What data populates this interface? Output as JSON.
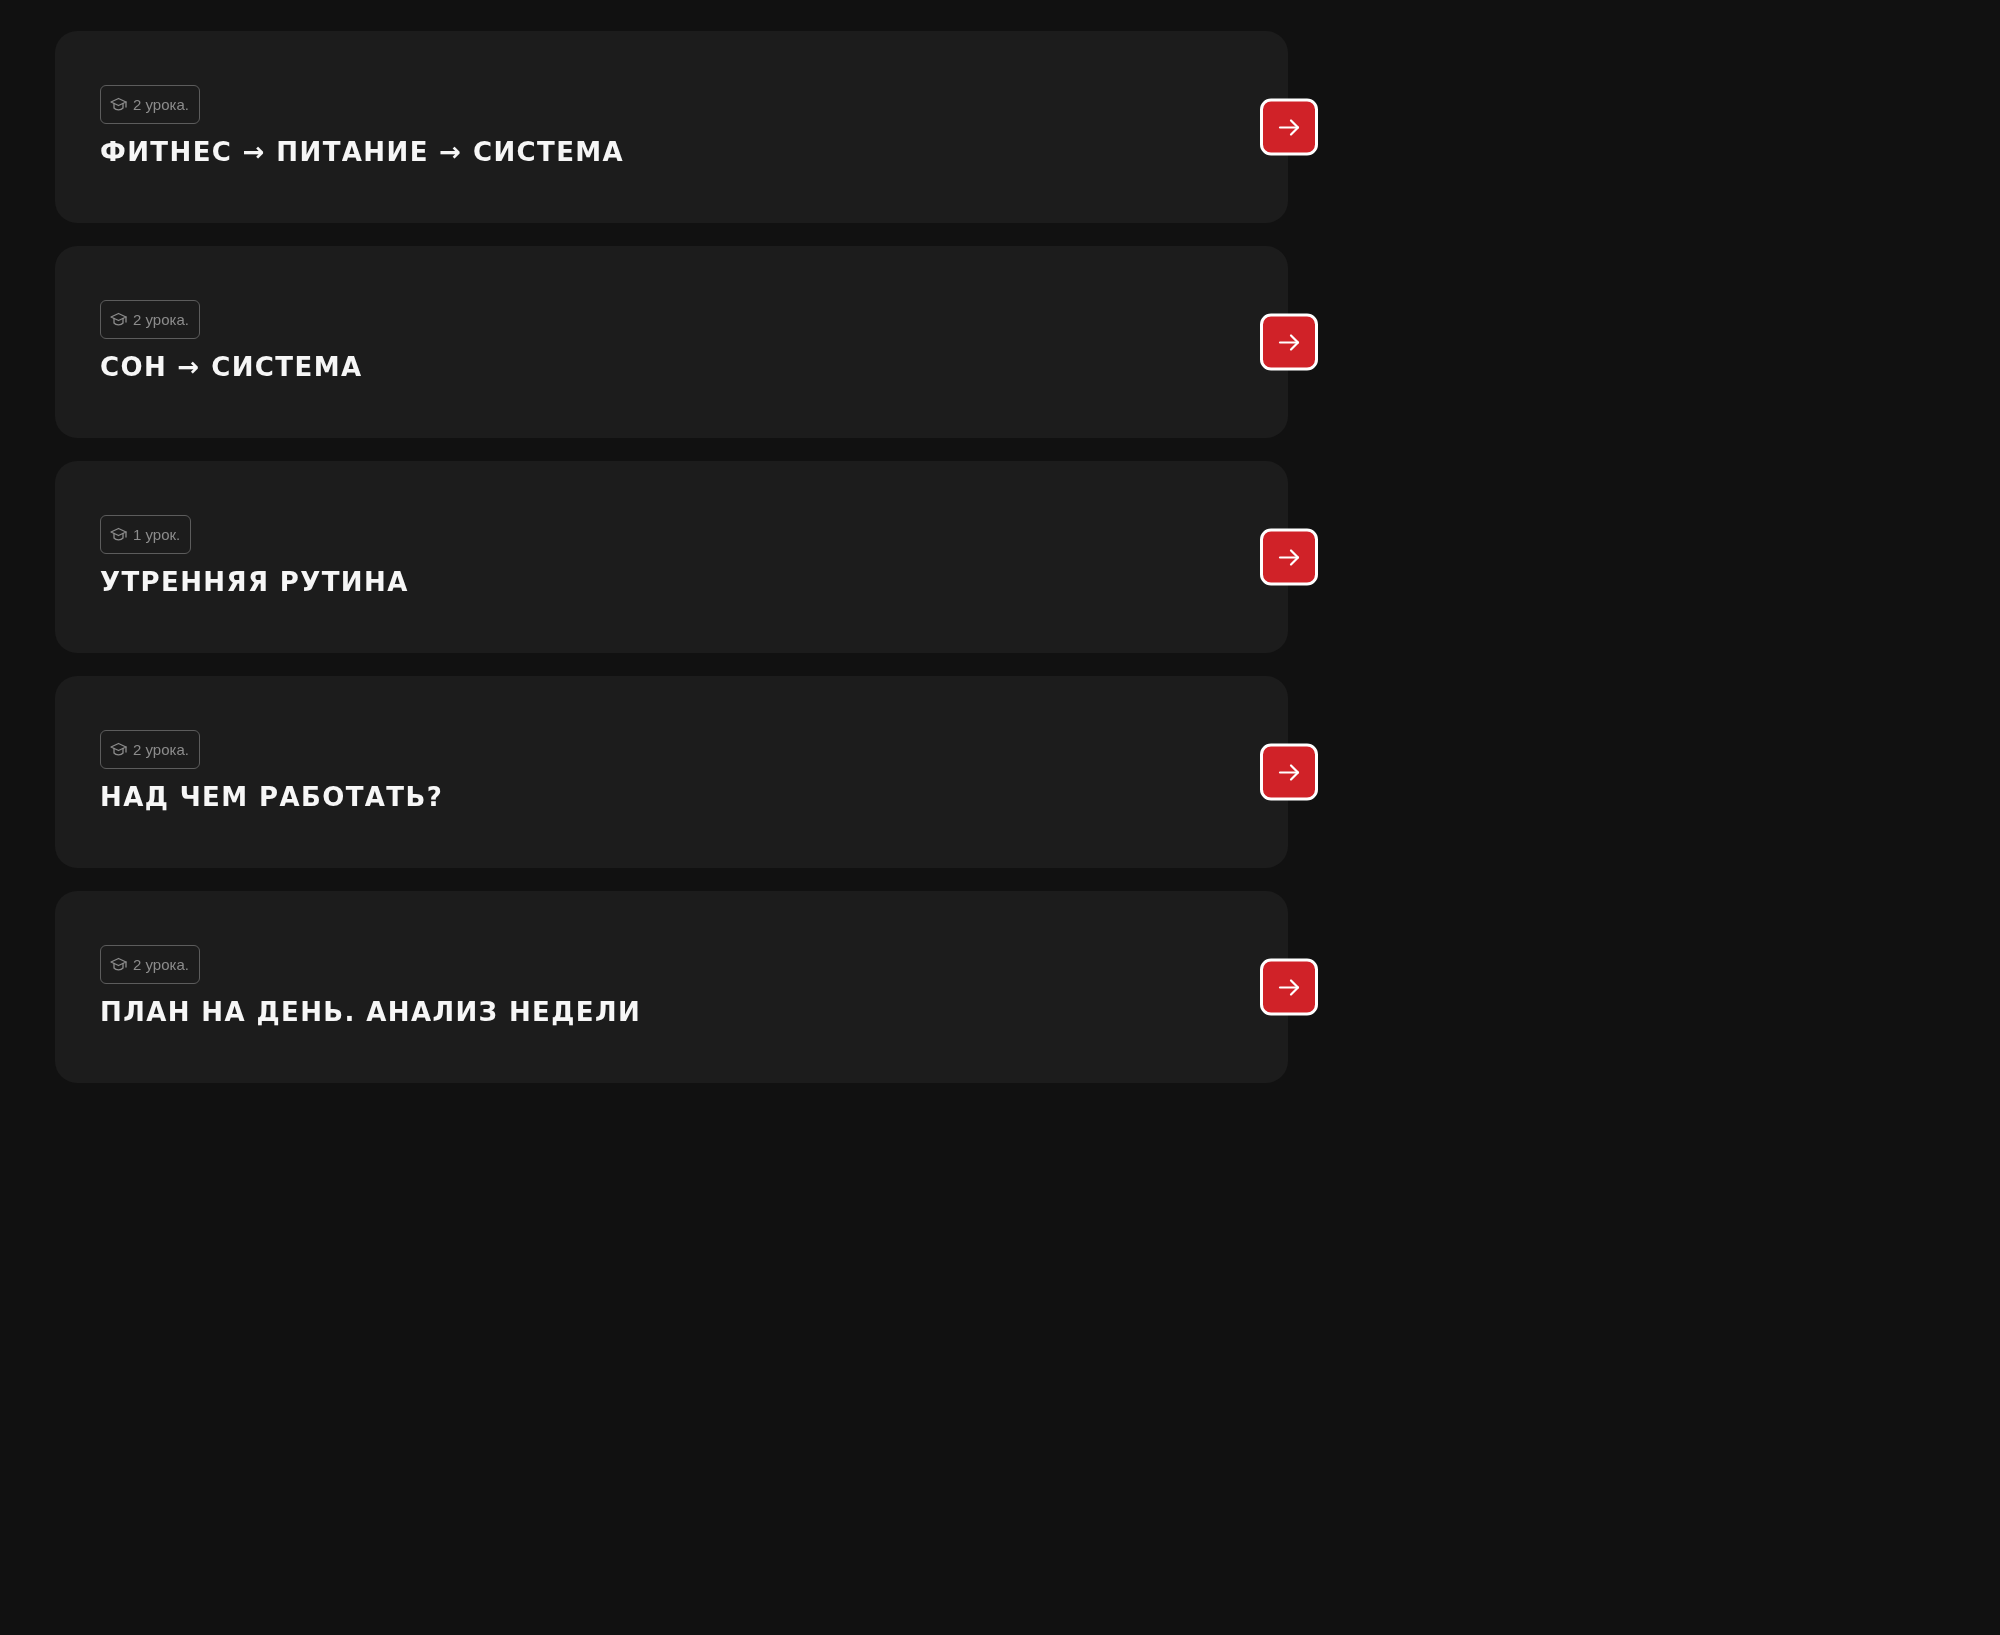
{
  "lessons": [
    {
      "badge": "2 урока.",
      "title": "ФИТНЕС → ПИТАНИЕ → СИСТЕМА"
    },
    {
      "badge": "2 урока.",
      "title": "СОН → СИСТЕМА"
    },
    {
      "badge": "1 урок.",
      "title": "УТРЕННЯЯ РУТИНА"
    },
    {
      "badge": "2 урока.",
      "title": "НАД ЧЕМ РАБОТАТЬ?"
    },
    {
      "badge": "2 урока.",
      "title": "ПЛАН НА ДЕНЬ. АНАЛИЗ НЕДЕЛИ"
    }
  ]
}
